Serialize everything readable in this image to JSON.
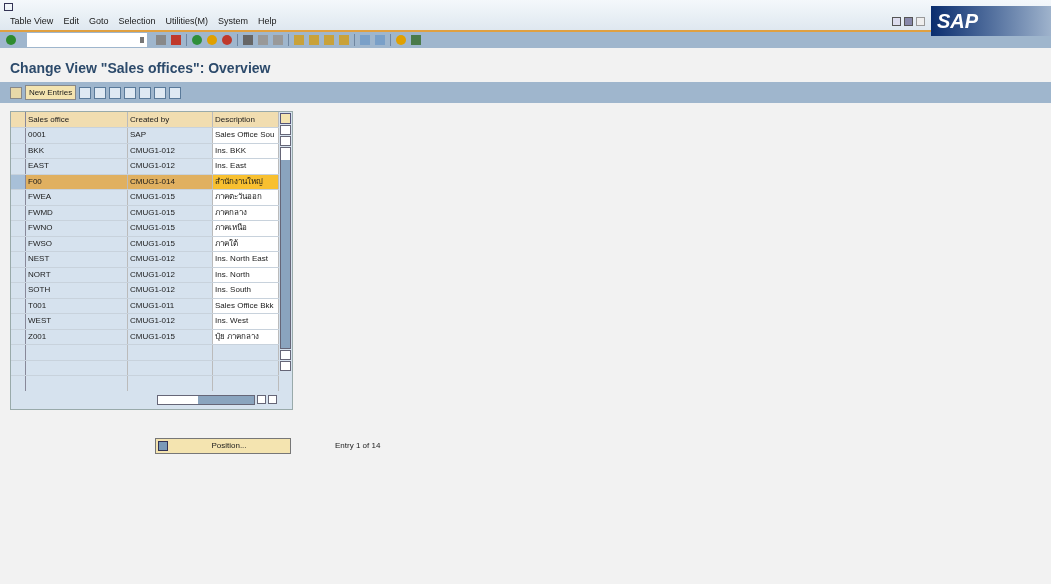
{
  "menu_bar": [
    "Table View",
    "Edit",
    "Goto",
    "Selection",
    "Utilities(M)",
    "System",
    "Help"
  ],
  "logo": "SAP",
  "screen_title": "Change View \"Sales offices\": Overview",
  "app_toolbar": {
    "new_entries_button": "New Entries"
  },
  "table": {
    "columns": [
      "Sales office",
      "Created by",
      "Description"
    ],
    "rows": [
      {
        "cells": [
          "0001",
          "SAP",
          "Sales Office Sou"
        ],
        "selected": false
      },
      {
        "cells": [
          "BKK",
          "CMUG1-012",
          "Ins. BKK"
        ],
        "selected": false
      },
      {
        "cells": [
          "EAST",
          "CMUG1-012",
          "Ins. East"
        ],
        "selected": false
      },
      {
        "cells": [
          "F00",
          "CMUG1-014",
          "สำนักงานใหญ่"
        ],
        "selected": true
      },
      {
        "cells": [
          "FWEA",
          "CMUG1-015",
          "ภาคตะวันออก"
        ],
        "selected": false
      },
      {
        "cells": [
          "FWMD",
          "CMUG1-015",
          "ภาคกลาง"
        ],
        "selected": false
      },
      {
        "cells": [
          "FWNO",
          "CMUG1-015",
          "ภาคเหนือ"
        ],
        "selected": false
      },
      {
        "cells": [
          "FWSO",
          "CMUG1-015",
          "ภาคใต้"
        ],
        "selected": false
      },
      {
        "cells": [
          "NEST",
          "CMUG1-012",
          "Ins. North East"
        ],
        "selected": false
      },
      {
        "cells": [
          "NORT",
          "CMUG1-012",
          "Ins. North"
        ],
        "selected": false
      },
      {
        "cells": [
          "SOTH",
          "CMUG1-012",
          "Ins. South"
        ],
        "selected": false
      },
      {
        "cells": [
          "T001",
          "CMUG1-011",
          "Sales Office Bkk"
        ],
        "selected": false
      },
      {
        "cells": [
          "WEST",
          "CMUG1-012",
          "Ins. West"
        ],
        "selected": false
      },
      {
        "cells": [
          "Z001",
          "CMUG1-015",
          "ปุ๋ย ภาคกลาง"
        ],
        "selected": false
      }
    ]
  },
  "position_button": "Position...",
  "entry_status": "Entry 1 of 14"
}
